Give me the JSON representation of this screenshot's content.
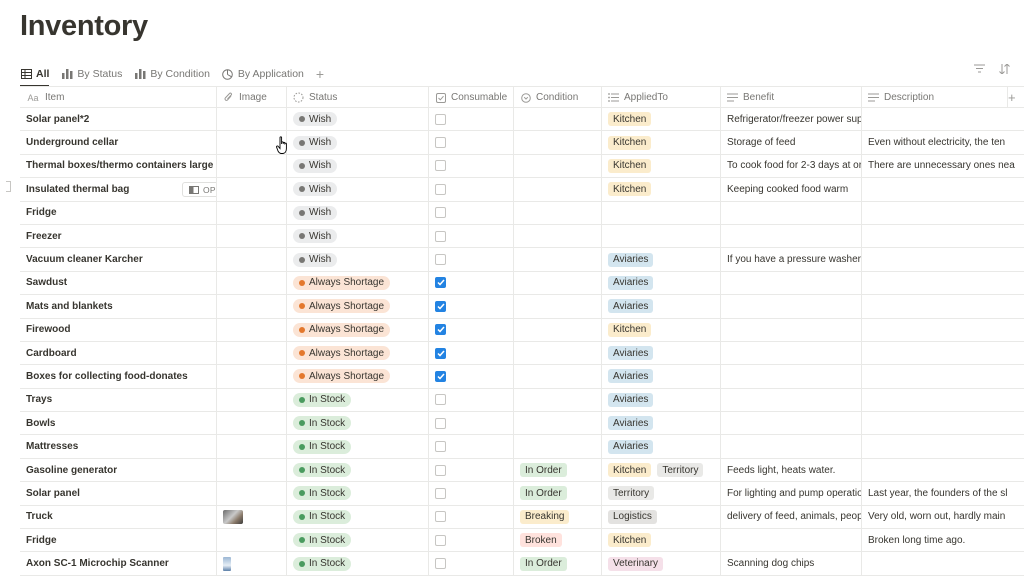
{
  "page": {
    "title": "Inventory"
  },
  "tabs": [
    {
      "label": "All",
      "icon": "table-icon",
      "active": true
    },
    {
      "label": "By Status",
      "icon": "bar-chart-icon"
    },
    {
      "label": "By Condition",
      "icon": "bar-chart-icon"
    },
    {
      "label": "By Application",
      "icon": "pie-chart-icon"
    }
  ],
  "columns": [
    {
      "label": "Item",
      "icon": "text-aa-icon"
    },
    {
      "label": "Image",
      "icon": "paperclip-icon"
    },
    {
      "label": "Status",
      "icon": "status-spinner-icon"
    },
    {
      "label": "Consumable",
      "icon": "checkbox-icon"
    },
    {
      "label": "Condition",
      "icon": "select-circle-icon"
    },
    {
      "label": "AppliedTo",
      "icon": "list-icon"
    },
    {
      "label": "Benefit",
      "icon": "lines-icon"
    },
    {
      "label": "Description",
      "icon": "lines-icon"
    }
  ],
  "open_label": "OPEN",
  "rows": [
    {
      "item": "Solar panel*2",
      "status": "Wish",
      "consumable": false,
      "condition": "",
      "applied": [
        "Kitchen"
      ],
      "benefit": "Refrigerator/freezer power supp",
      "description": ""
    },
    {
      "item": "Underground cellar",
      "status": "Wish",
      "consumable": false,
      "condition": "",
      "applied": [
        "Kitchen"
      ],
      "benefit": "Storage of feed",
      "description": "Even without electricity, the ten"
    },
    {
      "item": "Thermal boxes/thermo containers large",
      "status": "Wish",
      "consumable": false,
      "condition": "",
      "applied": [
        "Kitchen"
      ],
      "benefit": "To cook food for 2-3 days at or",
      "description": "There are unnecessary ones nea"
    },
    {
      "item": "Insulated thermal bag",
      "status": "Wish",
      "consumable": false,
      "condition": "",
      "applied": [
        "Kitchen"
      ],
      "benefit": "Keeping cooked food warm",
      "description": "",
      "hover": true
    },
    {
      "item": "Fridge",
      "status": "Wish",
      "consumable": false,
      "condition": "",
      "applied": [],
      "benefit": "",
      "description": ""
    },
    {
      "item": "Freezer",
      "status": "Wish",
      "consumable": false,
      "condition": "",
      "applied": [],
      "benefit": "",
      "description": ""
    },
    {
      "item": "Vacuum cleaner Karcher",
      "status": "Wish",
      "consumable": false,
      "condition": "",
      "applied": [
        "Aviaries"
      ],
      "benefit": "If you have a pressure washer, c",
      "description": ""
    },
    {
      "item": "Sawdust",
      "status": "Always Shortage",
      "consumable": true,
      "condition": "",
      "applied": [
        "Aviaries"
      ],
      "benefit": "",
      "description": ""
    },
    {
      "item": "Mats and blankets",
      "status": "Always Shortage",
      "consumable": true,
      "condition": "",
      "applied": [
        "Aviaries"
      ],
      "benefit": "",
      "description": ""
    },
    {
      "item": "Firewood",
      "status": "Always Shortage",
      "consumable": true,
      "condition": "",
      "applied": [
        "Kitchen"
      ],
      "benefit": "",
      "description": ""
    },
    {
      "item": "Cardboard",
      "status": "Always Shortage",
      "consumable": true,
      "condition": "",
      "applied": [
        "Aviaries"
      ],
      "benefit": "",
      "description": ""
    },
    {
      "item": "Boxes for collecting food-donates",
      "status": "Always Shortage",
      "consumable": true,
      "condition": "",
      "applied": [
        "Aviaries"
      ],
      "benefit": "",
      "description": ""
    },
    {
      "item": "Trays",
      "status": "In Stock",
      "consumable": false,
      "condition": "",
      "applied": [
        "Aviaries"
      ],
      "benefit": "",
      "description": ""
    },
    {
      "item": "Bowls",
      "status": "In Stock",
      "consumable": false,
      "condition": "",
      "applied": [
        "Aviaries"
      ],
      "benefit": "",
      "description": ""
    },
    {
      "item": "Mattresses",
      "status": "In Stock",
      "consumable": false,
      "condition": "",
      "applied": [
        "Aviaries"
      ],
      "benefit": "",
      "description": ""
    },
    {
      "item": "Gasoline generator",
      "status": "In Stock",
      "consumable": false,
      "condition": "In Order",
      "applied": [
        "Kitchen",
        "Territory"
      ],
      "benefit": "Feeds light, heats water.",
      "description": ""
    },
    {
      "item": "Solar panel",
      "status": "In Stock",
      "consumable": false,
      "condition": "In Order",
      "applied": [
        "Territory"
      ],
      "benefit": "For lighting and pump operatio",
      "description": "Last year, the founders of the sl"
    },
    {
      "item": "Truck",
      "status": "In Stock",
      "consumable": false,
      "condition": "Breaking",
      "applied": [
        "Logistics"
      ],
      "benefit": "delivery of feed, animals, peopl",
      "description": "Very old, worn out, hardly main",
      "image": "truck-photo"
    },
    {
      "item": "Fridge",
      "status": "In Stock",
      "consumable": false,
      "condition": "Broken",
      "applied": [
        "Kitchen"
      ],
      "benefit": "",
      "description": "Broken long time ago."
    },
    {
      "item": "Axon SC-1 Microchip Scanner",
      "status": "In Stock",
      "consumable": false,
      "condition": "In Order",
      "applied": [
        "Veterinary"
      ],
      "benefit": "Scanning dog chips",
      "description": "",
      "image": "scanner-photo"
    }
  ]
}
